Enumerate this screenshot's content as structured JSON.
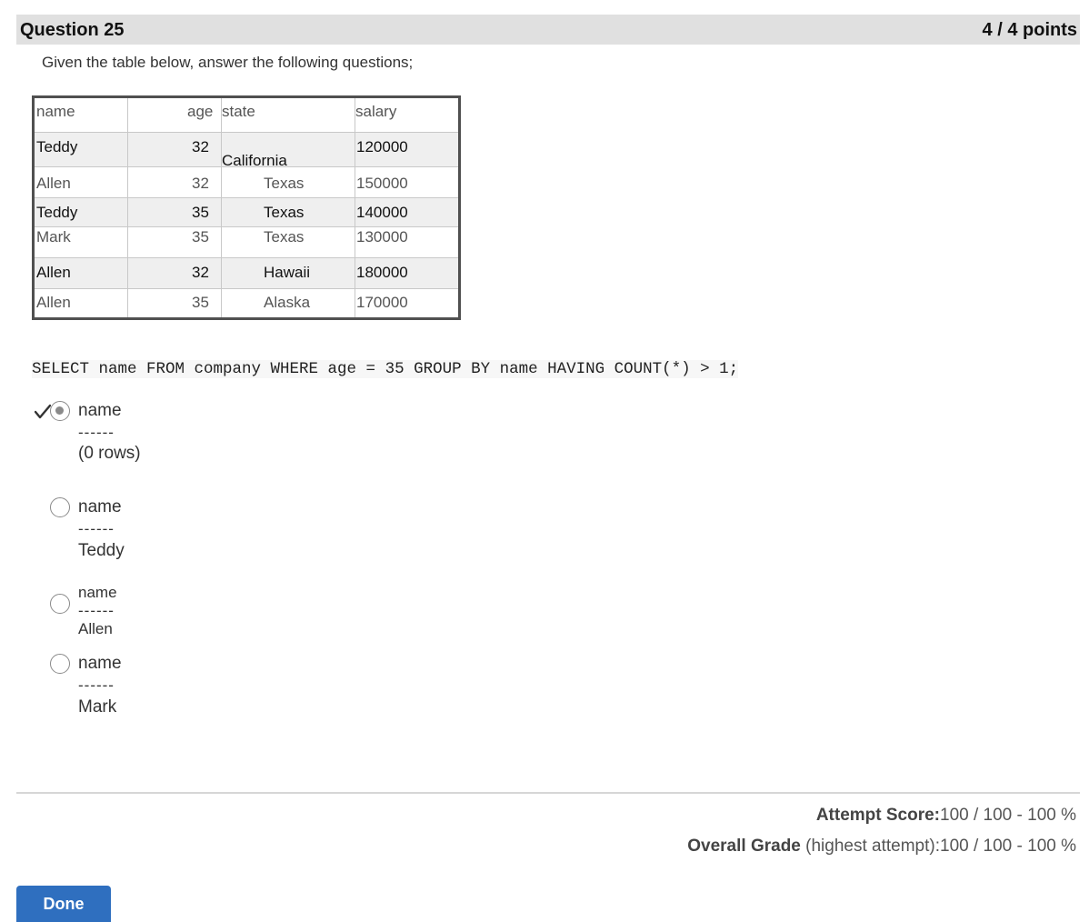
{
  "question": {
    "title": "Question 25",
    "points": "4 / 4 points",
    "prompt": "Given the table below, answer the following questions;"
  },
  "table": {
    "headers": [
      "name",
      "age",
      "state",
      "salary"
    ],
    "rows": [
      [
        "Teddy",
        "32",
        "California",
        "120000"
      ],
      [
        "Allen",
        "32",
        "Texas",
        "150000"
      ],
      [
        "Teddy",
        "35",
        "Texas",
        "140000"
      ],
      [
        "Mark",
        "35",
        "Texas",
        "130000"
      ],
      [
        "Allen",
        "32",
        "Hawaii",
        "180000"
      ],
      [
        "Allen",
        "35",
        "Alaska",
        "170000"
      ]
    ]
  },
  "sql": "SELECT name FROM company WHERE age = 35 GROUP BY name HAVING COUNT(*) > 1;",
  "options": [
    {
      "header": "name",
      "dashes": "------",
      "value": "(0 rows)",
      "selected": true,
      "correct": true
    },
    {
      "header": "name",
      "dashes": "------",
      "value": "Teddy",
      "selected": false
    },
    {
      "header": "name",
      "dashes": "------",
      "value": "Allen",
      "selected": false
    },
    {
      "header": "name",
      "dashes": "------",
      "value": "Mark",
      "selected": false
    }
  ],
  "scores": {
    "attempt_label": "Attempt Score:",
    "attempt_value": "100 / 100 - 100 %",
    "overall_label": "Overall Grade",
    "overall_note": " (highest attempt):",
    "overall_value": "100 / 100 - 100 %"
  },
  "done_label": "Done",
  "colors": {
    "done_button": "#2f6fbf",
    "header_band": "#e0e0e0",
    "check": "#333333"
  },
  "icons": [
    "checkmark-icon",
    "radio-button"
  ]
}
